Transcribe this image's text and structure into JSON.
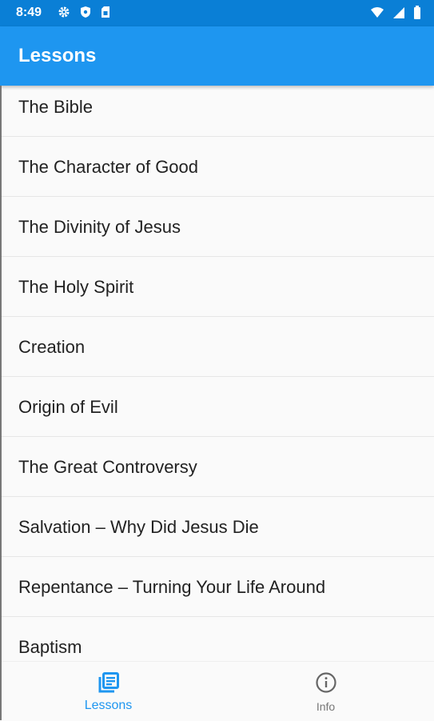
{
  "status_bar": {
    "time": "8:49",
    "icons_left": [
      "settings-icon",
      "shield-icon",
      "sim-card-icon"
    ],
    "icons_right": [
      "wifi-icon",
      "cellular-signal-icon",
      "battery-icon"
    ]
  },
  "app_bar": {
    "title": "Lessons"
  },
  "lessons": [
    "The Bible",
    "The Character of Good",
    "The Divinity of Jesus",
    "The Holy Spirit",
    "Creation",
    "Origin of Evil",
    "The Great Controversy",
    "Salvation – Why Did Jesus Die",
    "Repentance – Turning Your Life Around",
    "Baptism"
  ],
  "bottom_nav": {
    "items": [
      {
        "label": "Lessons",
        "icon": "library-books-icon",
        "active": true
      },
      {
        "label": "Info",
        "icon": "info-icon",
        "active": false
      }
    ]
  },
  "colors": {
    "status_bar": "#0a7fd6",
    "app_bar": "#1e96f0",
    "active_nav": "#1e96f0",
    "inactive_nav": "#777777"
  }
}
